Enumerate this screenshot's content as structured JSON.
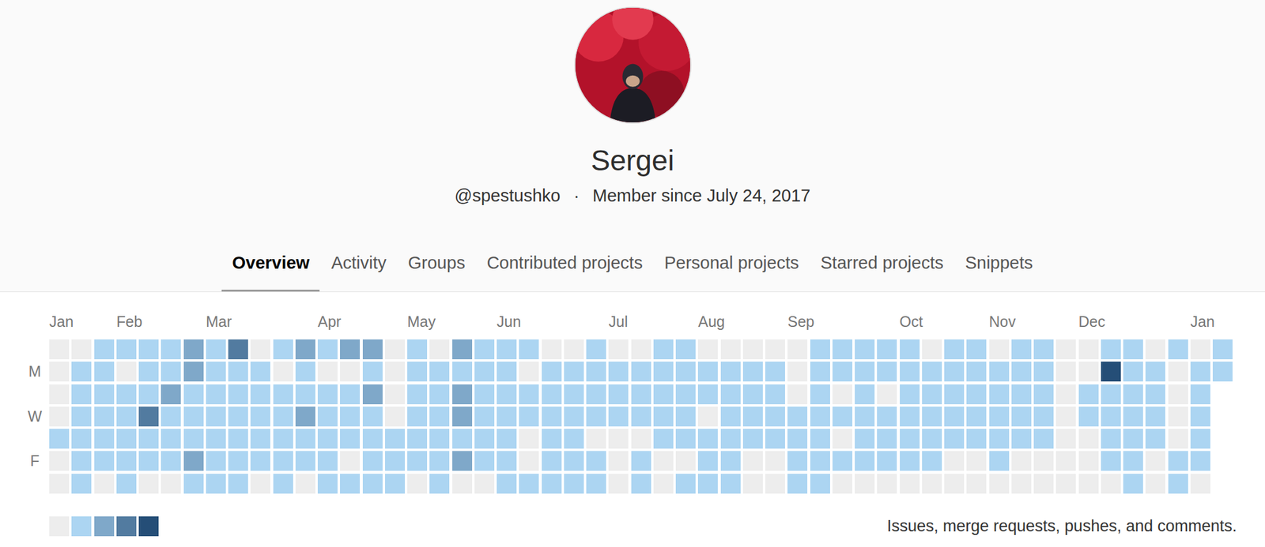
{
  "user": {
    "name": "Sergei",
    "username": "@spestushko",
    "separator": "·",
    "member_since": "Member since July 24, 2017"
  },
  "tabs": [
    {
      "label": "Overview",
      "selected": true
    },
    {
      "label": "Activity",
      "selected": false
    },
    {
      "label": "Groups",
      "selected": false
    },
    {
      "label": "Contributed projects",
      "selected": false
    },
    {
      "label": "Personal projects",
      "selected": false
    },
    {
      "label": "Starred projects",
      "selected": false
    },
    {
      "label": "Snippets",
      "selected": false
    }
  ],
  "calendar": {
    "months": [
      {
        "label": "Jan",
        "week": 0
      },
      {
        "label": "Feb",
        "week": 3
      },
      {
        "label": "Mar",
        "week": 7
      },
      {
        "label": "Apr",
        "week": 12
      },
      {
        "label": "May",
        "week": 16
      },
      {
        "label": "Jun",
        "week": 20
      },
      {
        "label": "Jul",
        "week": 25
      },
      {
        "label": "Aug",
        "week": 29
      },
      {
        "label": "Sep",
        "week": 33
      },
      {
        "label": "Oct",
        "week": 38
      },
      {
        "label": "Nov",
        "week": 42
      },
      {
        "label": "Dec",
        "week": 46
      },
      {
        "label": "Jan",
        "week": 51
      }
    ],
    "day_labels": [
      "",
      "M",
      "",
      "W",
      "",
      "F",
      ""
    ],
    "weeks": [
      [
        0,
        0,
        0,
        0,
        1,
        0,
        0
      ],
      [
        0,
        1,
        1,
        1,
        1,
        1,
        1
      ],
      [
        1,
        1,
        1,
        1,
        1,
        1,
        0
      ],
      [
        1,
        0,
        1,
        1,
        1,
        1,
        1
      ],
      [
        1,
        1,
        1,
        3,
        1,
        1,
        0
      ],
      [
        1,
        1,
        2,
        1,
        1,
        1,
        0
      ],
      [
        2,
        2,
        1,
        1,
        1,
        2,
        1
      ],
      [
        1,
        1,
        1,
        1,
        1,
        1,
        1
      ],
      [
        3,
        1,
        1,
        1,
        1,
        1,
        1
      ],
      [
        0,
        1,
        1,
        1,
        1,
        1,
        0
      ],
      [
        1,
        0,
        1,
        1,
        1,
        1,
        1
      ],
      [
        2,
        1,
        1,
        2,
        1,
        1,
        0
      ],
      [
        1,
        0,
        1,
        1,
        1,
        1,
        1
      ],
      [
        2,
        0,
        1,
        1,
        1,
        0,
        1
      ],
      [
        2,
        1,
        2,
        1,
        1,
        1,
        1
      ],
      [
        0,
        0,
        0,
        0,
        1,
        1,
        1
      ],
      [
        1,
        1,
        1,
        1,
        1,
        1,
        0
      ],
      [
        0,
        1,
        1,
        1,
        1,
        1,
        1
      ],
      [
        2,
        1,
        2,
        2,
        1,
        2,
        0
      ],
      [
        1,
        1,
        1,
        1,
        1,
        1,
        0
      ],
      [
        1,
        1,
        1,
        1,
        1,
        1,
        1
      ],
      [
        1,
        0,
        1,
        1,
        0,
        0,
        1
      ],
      [
        0,
        1,
        1,
        1,
        1,
        1,
        1
      ],
      [
        0,
        1,
        1,
        1,
        1,
        1,
        1
      ],
      [
        1,
        1,
        1,
        1,
        0,
        1,
        1
      ],
      [
        0,
        1,
        1,
        1,
        0,
        0,
        0
      ],
      [
        0,
        1,
        1,
        1,
        0,
        1,
        1
      ],
      [
        1,
        1,
        1,
        1,
        1,
        0,
        0
      ],
      [
        1,
        1,
        1,
        1,
        1,
        0,
        1
      ],
      [
        0,
        1,
        1,
        0,
        1,
        1,
        1
      ],
      [
        0,
        1,
        1,
        1,
        1,
        1,
        1
      ],
      [
        0,
        1,
        1,
        1,
        1,
        0,
        0
      ],
      [
        0,
        1,
        1,
        1,
        1,
        0,
        0
      ],
      [
        0,
        0,
        0,
        1,
        1,
        1,
        1
      ],
      [
        1,
        1,
        1,
        1,
        1,
        1,
        1
      ],
      [
        1,
        1,
        0,
        1,
        0,
        1,
        0
      ],
      [
        1,
        1,
        1,
        1,
        1,
        1,
        0
      ],
      [
        1,
        1,
        0,
        1,
        1,
        1,
        0
      ],
      [
        1,
        1,
        1,
        1,
        1,
        1,
        0
      ],
      [
        0,
        1,
        1,
        1,
        1,
        1,
        0
      ],
      [
        1,
        1,
        1,
        1,
        1,
        0,
        0
      ],
      [
        1,
        1,
        1,
        1,
        1,
        0,
        0
      ],
      [
        0,
        1,
        1,
        1,
        1,
        1,
        0
      ],
      [
        1,
        1,
        1,
        1,
        1,
        0,
        0
      ],
      [
        1,
        1,
        1,
        1,
        1,
        0,
        0
      ],
      [
        0,
        0,
        0,
        0,
        0,
        0,
        0
      ],
      [
        0,
        0,
        1,
        1,
        0,
        0,
        0
      ],
      [
        1,
        4,
        1,
        1,
        1,
        1,
        0
      ],
      [
        1,
        1,
        1,
        1,
        1,
        1,
        1
      ],
      [
        0,
        1,
        1,
        1,
        1,
        0,
        0
      ],
      [
        1,
        0,
        0,
        0,
        0,
        1,
        1
      ],
      [
        0,
        1,
        1,
        1,
        1,
        1,
        0
      ],
      [
        1,
        1
      ]
    ],
    "legend": {
      "levels": [
        0,
        1,
        2,
        3,
        4
      ],
      "caption": "Issues, merge requests, pushes, and comments."
    }
  }
}
